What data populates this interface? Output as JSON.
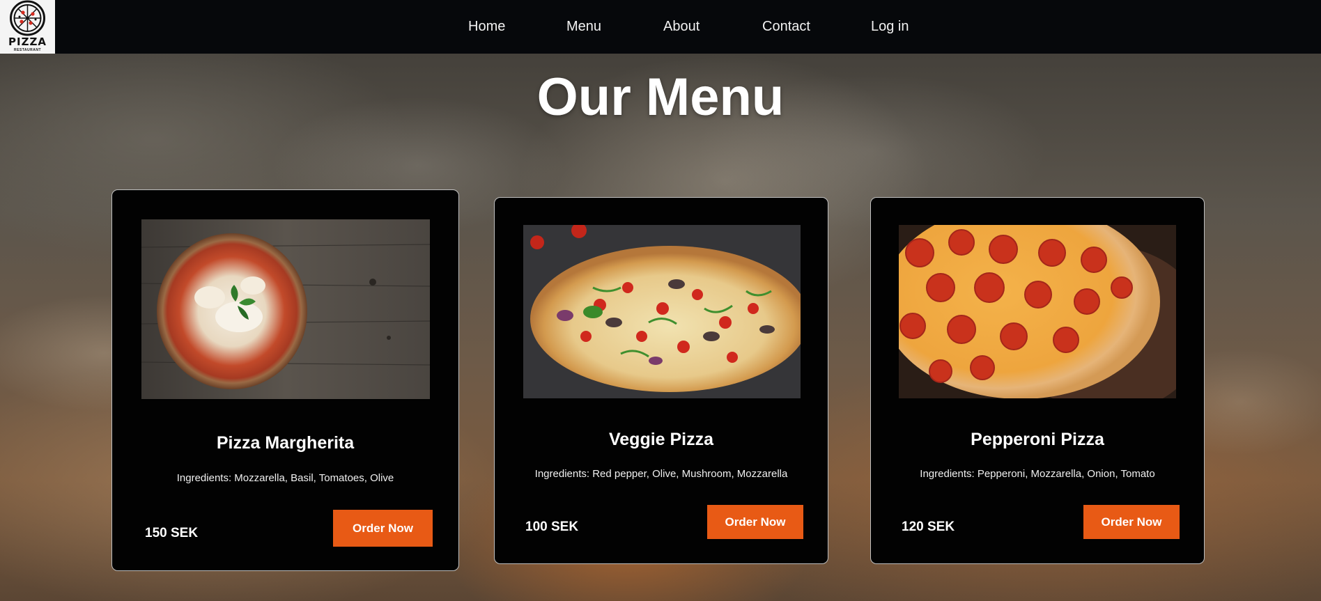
{
  "nav": {
    "logo_text": "PIZZA",
    "logo_sub": "RESTAURANT",
    "links": [
      "Home",
      "Menu",
      "About",
      "Contact",
      "Log in"
    ]
  },
  "page": {
    "title": "Our Menu"
  },
  "menu": [
    {
      "name": "Pizza Margherita",
      "ingredients": "Ingredients: Mozzarella, Basil, Tomatoes, Olive",
      "price": "150 SEK",
      "button": "Order Now"
    },
    {
      "name": "Veggie Pizza",
      "ingredients": "Ingredients: Red pepper, Olive, Mushroom, Mozzarella",
      "price": "100 SEK",
      "button": "Order Now"
    },
    {
      "name": "Pepperoni Pizza",
      "ingredients": "Ingredients: Pepperoni, Mozzarella, Onion, Tomato",
      "price": "120 SEK",
      "button": "Order Now"
    }
  ],
  "colors": {
    "nav_bg": "#06080b",
    "card_bg": "#020202",
    "accent": "#e85a15",
    "text": "#ffffff"
  }
}
